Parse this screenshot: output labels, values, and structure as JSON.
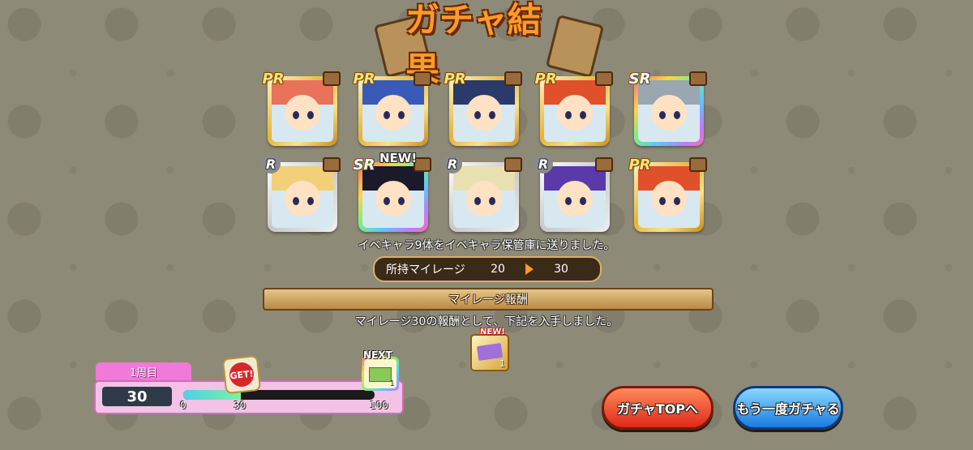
{
  "title": "ガチャ結果",
  "cards": [
    {
      "rarity": "PR",
      "frame": "pr",
      "hair_color": "#e8735a",
      "new": false
    },
    {
      "rarity": "PR",
      "frame": "pr",
      "hair_color": "#3a5ab8",
      "new": false
    },
    {
      "rarity": "PR",
      "frame": "pr",
      "hair_color": "#2a3a6a",
      "new": false
    },
    {
      "rarity": "PR",
      "frame": "pr",
      "hair_color": "#e0502a",
      "new": false
    },
    {
      "rarity": "SR",
      "frame": "sr",
      "hair_color": "#9aa6b0",
      "new": false
    },
    {
      "rarity": "R",
      "frame": "r",
      "hair_color": "#f2d07a",
      "new": false
    },
    {
      "rarity": "SR",
      "frame": "sr",
      "hair_color": "#1a1a2a",
      "new": true,
      "new_label": "NEW!"
    },
    {
      "rarity": "R",
      "frame": "r",
      "hair_color": "#e8e0b0",
      "new": false
    },
    {
      "rarity": "R",
      "frame": "r",
      "hair_color": "#5a3aa8",
      "new": false
    },
    {
      "rarity": "PR",
      "frame": "pr",
      "hair_color": "#e0502a",
      "new": false
    }
  ],
  "sent_message": "イベキャラ9体をイベキャラ保管庫に送りました。",
  "mileage": {
    "label": "所持マイレージ",
    "before": "20",
    "after": "30"
  },
  "reward": {
    "header": "マイレージ報酬",
    "message": "マイレージ30の報酬として、下記を入手しました。",
    "item_new_label": "NEW!",
    "item_count": "1"
  },
  "lap": {
    "tab_label": "1周目",
    "count": "30",
    "progress": 0.3,
    "scale_start": "0",
    "scale_current": "30",
    "scale_end": "100",
    "get_label": "GET!",
    "next_label": "NEXT",
    "next_count": "1"
  },
  "buttons": {
    "gacha_top": "ガチャTOPへ",
    "again": "もう一度ガチャる"
  }
}
